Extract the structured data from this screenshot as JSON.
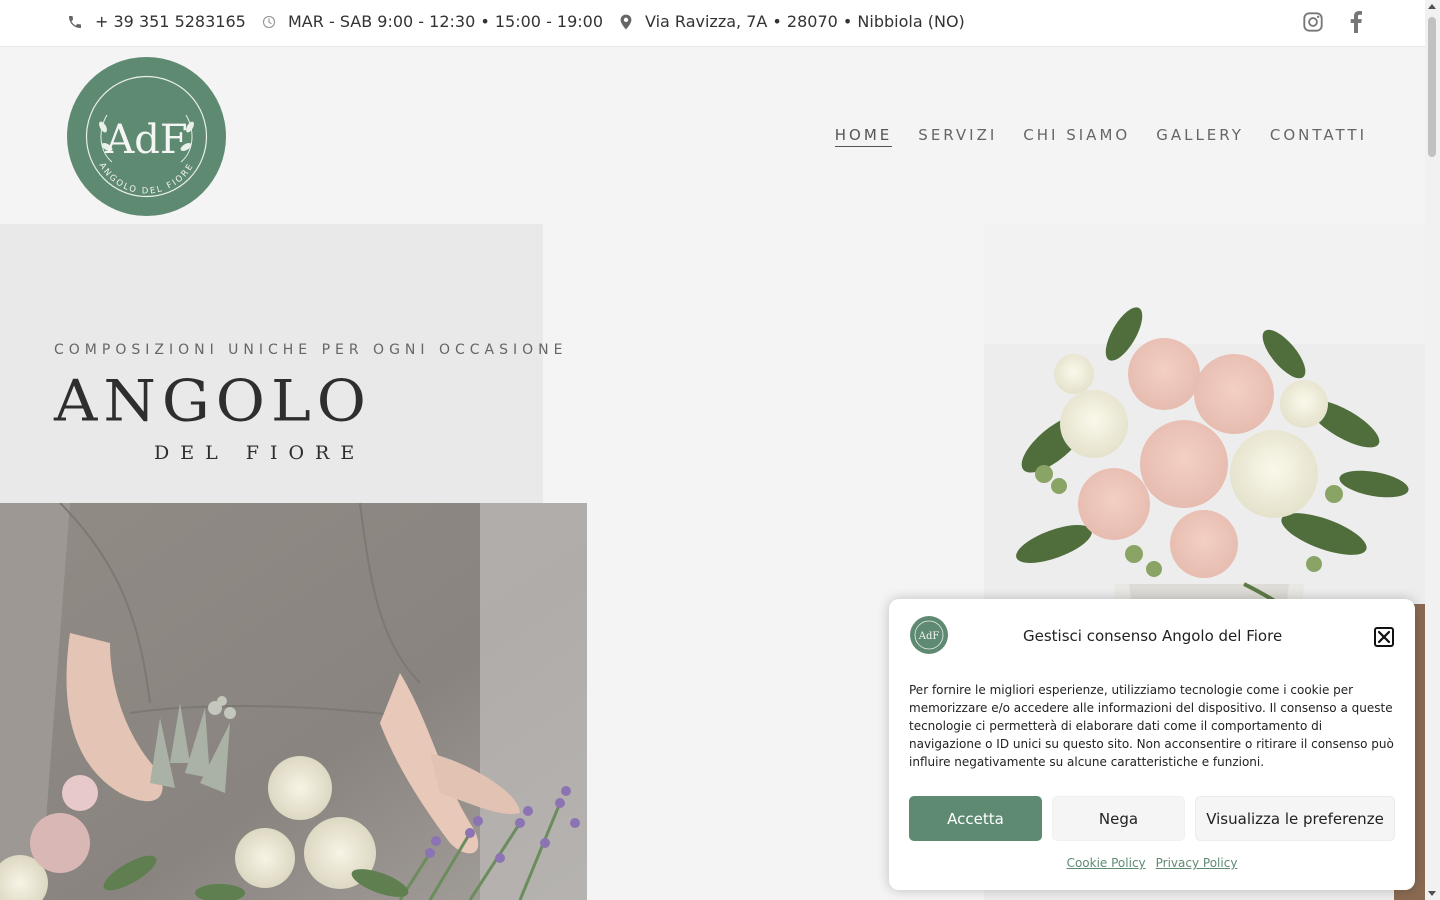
{
  "topbar": {
    "phone": "+ 39 351 5283165",
    "hours": "MAR - SAB 9:00 - 12:30 • 15:00 - 19:00",
    "address": "Via Ravizza, 7A • 28070 • Nibbiola (NO)"
  },
  "icons": {
    "phone": "phone-icon",
    "clock": "clock-icon",
    "pin": "map-pin-icon",
    "instagram": "instagram-icon",
    "facebook": "facebook-icon",
    "close": "close-icon"
  },
  "logo": {
    "monogram": "AdF",
    "ring_text": "ANGOLO DEL FIORE"
  },
  "nav": {
    "items": [
      {
        "label": "HOME",
        "active": true
      },
      {
        "label": "SERVIZI",
        "active": false
      },
      {
        "label": "CHI SIAMO",
        "active": false
      },
      {
        "label": "GALLERY",
        "active": false
      },
      {
        "label": "CONTATTI",
        "active": false
      }
    ]
  },
  "hero": {
    "tagline": "COMPOSIZIONI UNICHE PER OGNI OCCASIONE",
    "brand_main": "ANGOLO",
    "brand_sub": "DEL FIORE"
  },
  "cookie": {
    "title": "Gestisci consenso Angolo del Fiore",
    "body": "Per fornire le migliori esperienze, utilizziamo tecnologie come i cookie per memorizzare e/o accedere alle informazioni del dispositivo. Il consenso a queste tecnologie ci permetterà di elaborare dati come il comportamento di navigazione o ID unici su questo sito. Non acconsentire o ritirare il consenso può influire negativamente su alcune caratteristiche e funzioni.",
    "accept_label": "Accetta",
    "deny_label": "Nega",
    "prefs_label": "Visualizza le preferenze",
    "cookie_policy_label": "Cookie Policy",
    "privacy_policy_label": "Privacy Policy"
  },
  "colors": {
    "brand_green": "#5f8a72",
    "background": "#f4f4f4",
    "hero_panel": "#e8e9e8"
  }
}
